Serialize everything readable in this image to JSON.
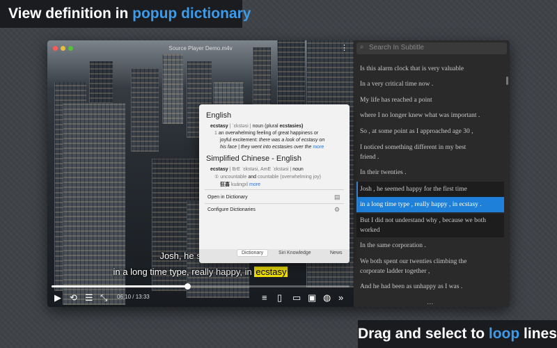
{
  "banner_top": {
    "prefix": "View definition in ",
    "highlight": "popup dictionary"
  },
  "banner_bottom": {
    "prefix": "Drag and select to ",
    "highlight": "loop",
    "suffix": " lines"
  },
  "player": {
    "window_title": "Source Player Demo.m4v",
    "subtitle_line1": "Josh, he seemed ha",
    "subtitle_line2_before": "in a long time type, really happy, in ",
    "subtitle_selected_word": "ecstasy",
    "current_time": "06:10",
    "total_time": "13:33",
    "progress": 0.455,
    "menu_icon": "⋮"
  },
  "dictionary": {
    "section1_title": "English",
    "word": "ecstasy",
    "pron": "| ˈɛkstəsi |",
    "pos": "noun",
    "plural_label": "(plural",
    "plural": "ecstasies)",
    "sense_num": "1",
    "def_line1": "an overwhelming feeling of great happiness or",
    "def_line2": "joyful excitement:",
    "ex_line2": "there was a look of ecstasy on",
    "ex_line3": "his face | they went into ecstasies over the",
    "more": "more",
    "section2_title": "Simplified Chinese - English",
    "zh_word": "ecstasy",
    "zh_pron": "| BrE ˈɛkstəsi,  AmE ˈɛkstəsi |",
    "zh_pos": "noun",
    "zh_sense": "① uncountable",
    "zh_and": "and",
    "zh_rest": "countable (overwhelming joy)",
    "zh_translation": "狂喜",
    "zh_pinyin": "kuángxǐ",
    "open_in": "Open in Dictionary",
    "configure": "Configure Dictionaries",
    "tabs": [
      "Dictionary",
      "Siri Knowledge",
      "News"
    ]
  },
  "sidebar": {
    "search_placeholder": "Search In Subtitle",
    "lines": [
      "Is this alarm clock that is very valuable",
      "In a very critical time now .",
      "My life has reached a point",
      "where I no longer knew what was important .",
      "So , at some point as I approached age 30 ,",
      "I noticed something different in my best",
      "friend .",
      "In their twenties .",
      "Josh , he seemed happy for the first time",
      "in a long time type , really happy , in ecstasy .",
      "But I did not understand why , because we both",
      "worked",
      "In the same corporation .",
      "We both spent our twenties climbing the",
      "corporate ladder together ,",
      "And he had been as unhappy as I was ."
    ],
    "more_indicator": "…"
  },
  "colors": {
    "accent": "#3d9be9",
    "selection": "#1e80d8",
    "highlight_word": "#f5e400"
  }
}
